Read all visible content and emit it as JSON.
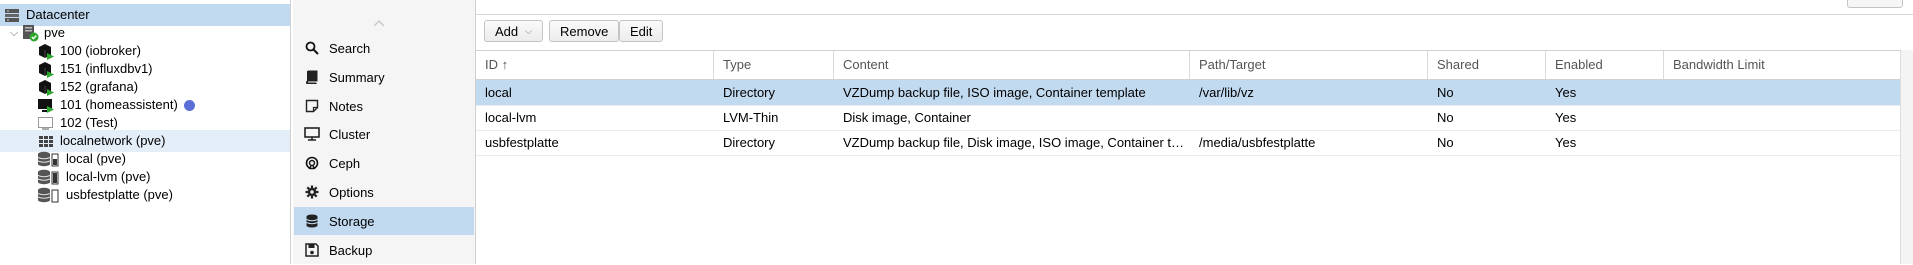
{
  "colors": {
    "selection": "#c2daf0",
    "running": "#2da62d",
    "online_dot": "#5b6fd6"
  },
  "tree": {
    "datacenter": {
      "label": "Datacenter",
      "icon": "server-icon"
    },
    "node": {
      "label": "pve",
      "icon": "node-online-icon",
      "expander": "chevron-down-icon"
    },
    "items": [
      {
        "label": "100 (iobroker)",
        "icon": "container-running-icon"
      },
      {
        "label": "151 (influxdbv1)",
        "icon": "container-running-icon"
      },
      {
        "label": "152 (grafana)",
        "icon": "container-running-icon"
      },
      {
        "label": "101 (homeassistent)",
        "icon": "vm-running-icon"
      },
      {
        "label": "102 (Test)",
        "icon": "vm-stopped-icon"
      },
      {
        "label": "localnetwork (pve)",
        "icon": "network-grid-icon"
      },
      {
        "label": "local (pve)",
        "icon": "storage-icon"
      },
      {
        "label": "local-lvm (pve)",
        "icon": "storage-icon"
      },
      {
        "label": "usbfestplatte (pve)",
        "icon": "storage-icon"
      }
    ]
  },
  "nav": {
    "items": [
      {
        "label": "Search",
        "icon": "search-icon"
      },
      {
        "label": "Summary",
        "icon": "book-icon"
      },
      {
        "label": "Notes",
        "icon": "note-icon"
      },
      {
        "label": "Cluster",
        "icon": "cluster-icon"
      },
      {
        "label": "Ceph",
        "icon": "ceph-icon"
      },
      {
        "label": "Options",
        "icon": "gear-icon"
      },
      {
        "label": "Storage",
        "icon": "database-icon"
      },
      {
        "label": "Backup",
        "icon": "floppy-icon"
      }
    ],
    "selected": "Storage"
  },
  "toolbar": {
    "add_label": "Add",
    "remove_label": "Remove",
    "edit_label": "Edit"
  },
  "grid": {
    "columns": [
      "ID ↑",
      "Type",
      "Content",
      "Path/Target",
      "Shared",
      "Enabled",
      "Bandwidth Limit"
    ],
    "rows": [
      [
        "local",
        "Directory",
        "VZDump backup file, ISO image, Container template",
        "/var/lib/vz",
        "No",
        "Yes",
        ""
      ],
      [
        "local-lvm",
        "LVM-Thin",
        "Disk image, Container",
        "",
        "No",
        "Yes",
        ""
      ],
      [
        "usbfestplatte",
        "Directory",
        "VZDump backup file, Disk image, ISO image, Container template",
        "/media/usbfestplatte",
        "No",
        "Yes",
        ""
      ]
    ],
    "selected_row": 0
  }
}
